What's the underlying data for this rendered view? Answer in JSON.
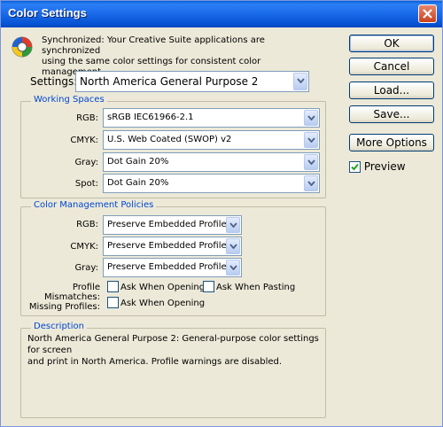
{
  "window": {
    "title": "Color Settings"
  },
  "sync": {
    "line1": "Synchronized: Your Creative Suite applications are synchronized",
    "line2": "using the same color settings for consistent color management."
  },
  "buttons": {
    "ok": "OK",
    "cancel": "Cancel",
    "load": "Load...",
    "save": "Save...",
    "more_options": "More Options"
  },
  "preview": {
    "label": "Preview",
    "checked": true
  },
  "settings": {
    "label": "Settings:",
    "value": "North America General Purpose 2"
  },
  "working_spaces": {
    "title": "Working Spaces",
    "rgb": {
      "label": "RGB:",
      "value": "sRGB IEC61966-2.1"
    },
    "cmyk": {
      "label": "CMYK:",
      "value": "U.S. Web Coated (SWOP) v2"
    },
    "gray": {
      "label": "Gray:",
      "value": "Dot Gain 20%"
    },
    "spot": {
      "label": "Spot:",
      "value": "Dot Gain 20%"
    }
  },
  "policies": {
    "title": "Color Management Policies",
    "rgb": {
      "label": "RGB:",
      "value": "Preserve Embedded Profiles"
    },
    "cmyk": {
      "label": "CMYK:",
      "value": "Preserve Embedded Profiles"
    },
    "gray": {
      "label": "Gray:",
      "value": "Preserve Embedded Profiles"
    },
    "mismatches": {
      "label": "Profile Mismatches:",
      "ask_opening": "Ask When Opening",
      "ask_pasting": "Ask When Pasting"
    },
    "missing": {
      "label": "Missing Profiles:",
      "ask_opening": "Ask When Opening"
    }
  },
  "description": {
    "title": "Description",
    "line1": "North America General Purpose 2:  General-purpose color settings for screen",
    "line2": "and print in North America. Profile warnings are disabled."
  },
  "colors": {
    "title_bar": "#0754d4",
    "group_title": "#0046d5",
    "dialog_bg": "#ece9d8"
  }
}
